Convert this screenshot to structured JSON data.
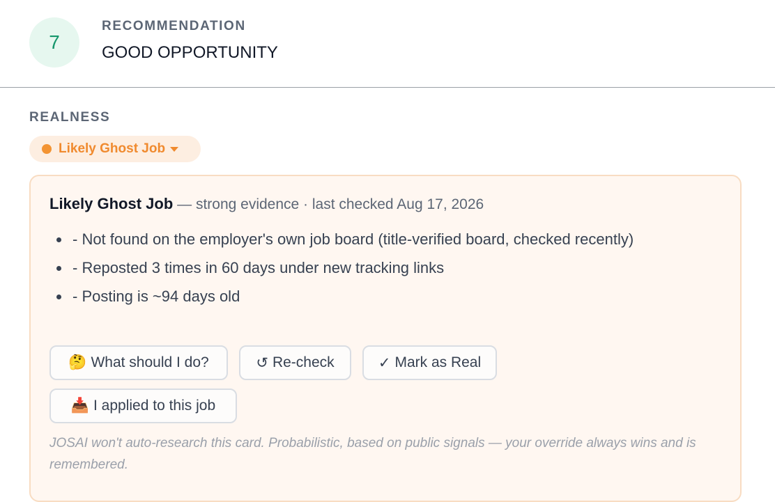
{
  "recommendation": {
    "score": "7",
    "label": "RECOMMENDATION",
    "value": "GOOD OPPORTUNITY"
  },
  "realness": {
    "label": "REALNESS",
    "status": "Likely Ghost Job",
    "status_color": "#f39433"
  },
  "card": {
    "title": "Likely Ghost Job",
    "meta": "— strong evidence · last checked Aug 17, 2026",
    "reasons": [
      "- Not found on the employer's own job board (title-verified board, checked recently)",
      "- Reposted 3 times in 60 days under new tracking links",
      "- Posting is ~94 days old"
    ],
    "buttons": {
      "what_to_do": {
        "icon": "🤔",
        "label": "What should I do?"
      },
      "recheck": {
        "icon": "↺",
        "label": "Re-check"
      },
      "mark_real": {
        "icon": "✓",
        "label": "Mark as Real"
      },
      "applied": {
        "icon": "📥",
        "label": "I applied to this job"
      }
    },
    "disclaimer": "JOSAI won't auto-research this card. Probabilistic, based on public signals — your override always wins and is remembered."
  },
  "colors": {
    "score_bg": "#e6f7ef",
    "score_text": "#15966b",
    "warning_accent": "#f08a2e",
    "card_bg": "#fff7f1",
    "card_border": "#f8dcc2"
  }
}
